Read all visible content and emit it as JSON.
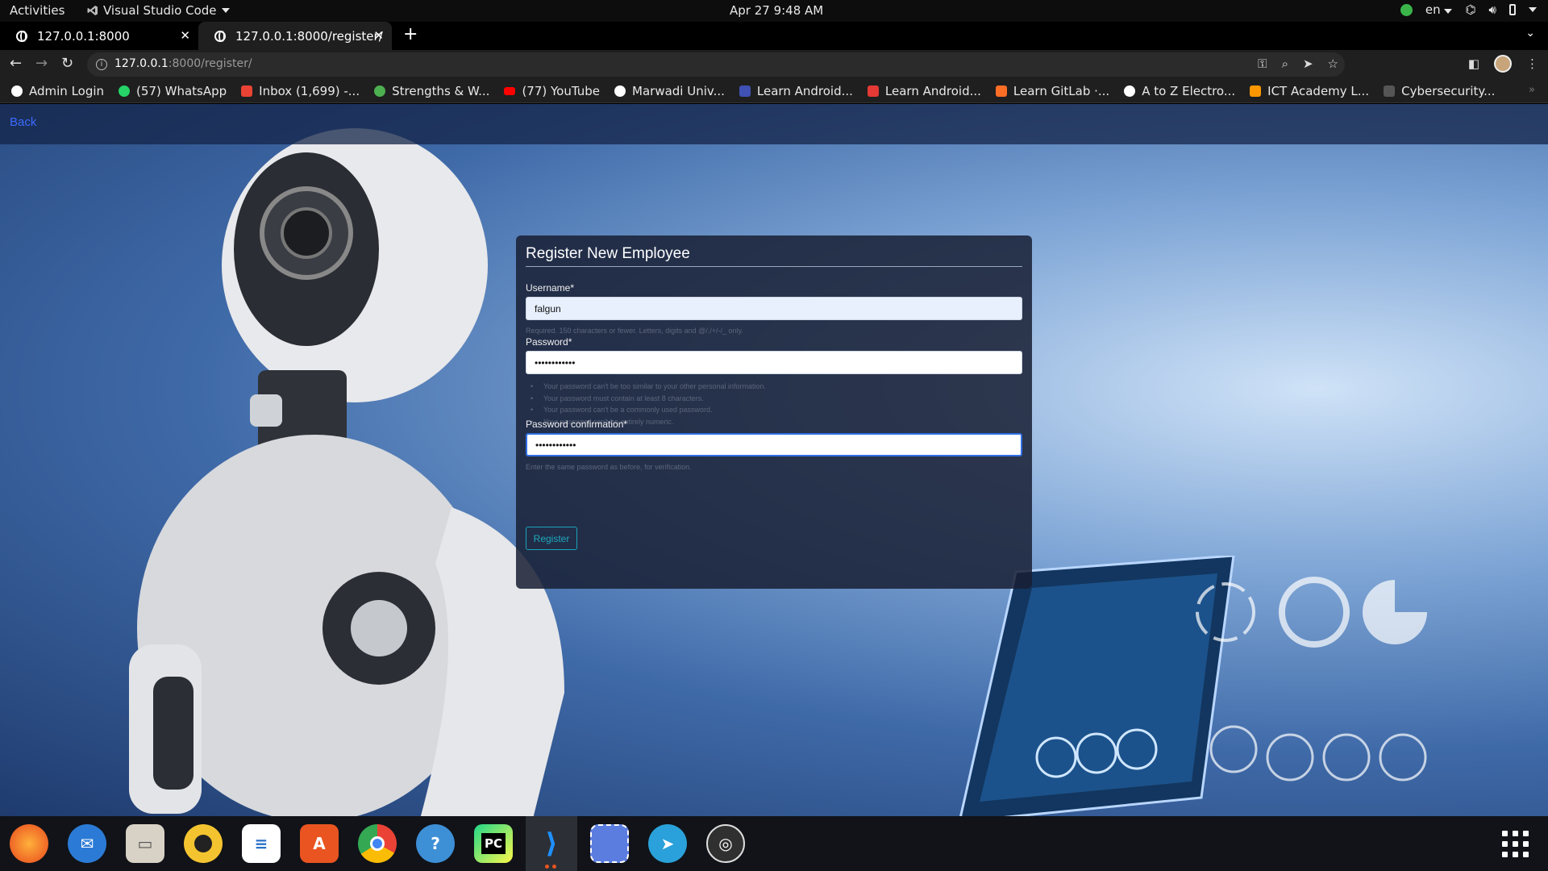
{
  "topbar": {
    "activities": "Activities",
    "app_name": "Visual Studio Code",
    "clock": "Apr 27  9:48 AM",
    "lang": "en"
  },
  "tabs": [
    {
      "title": "127.0.0.1:8000"
    },
    {
      "title": "127.0.0.1:8000/register/"
    }
  ],
  "address": {
    "host": "127.0.0.1",
    "path": ":8000/register/"
  },
  "bookmarks": [
    {
      "label": "Admin Login",
      "color": "#ffffff"
    },
    {
      "label": "(57) WhatsApp",
      "color": "#25d366"
    },
    {
      "label": "Inbox (1,699) -...",
      "color": "#ea4335"
    },
    {
      "label": "Strengths & W...",
      "color": "#4caf50"
    },
    {
      "label": "(77) YouTube",
      "color": "#ff0000"
    },
    {
      "label": "Marwadi Univ...",
      "color": "#ffffff"
    },
    {
      "label": "Learn Android...",
      "color": "#3f51b5"
    },
    {
      "label": "Learn Android...",
      "color": "#e53935"
    },
    {
      "label": "Learn GitLab ·...",
      "color": "#fc6d26"
    },
    {
      "label": "A to Z Electro...",
      "color": "#ffffff"
    },
    {
      "label": "ICT Academy L...",
      "color": "#ff9800"
    },
    {
      "label": "Cybersecurity...",
      "color": "#555555"
    }
  ],
  "page": {
    "back_link": "Back",
    "form": {
      "title": "Register New Employee",
      "username_label": "Username*",
      "username_value": "falgun",
      "username_help": "Required. 150 characters or fewer. Letters, digits and @/./+/-/_ only.",
      "password_label": "Password*",
      "password_value": "••••••••••••",
      "password_rules": [
        "Your password can't be too similar to your other personal information.",
        "Your password must contain at least 8 characters.",
        "Your password can't be a commonly used password.",
        "Your password can't be entirely numeric."
      ],
      "password2_label": "Password confirmation*",
      "password2_value": "••••••••••••",
      "password2_help": "Enter the same password as before, for verification.",
      "submit_label": "Register"
    }
  },
  "dock": {
    "apps": [
      {
        "name": "firefox",
        "color": "#ff7139"
      },
      {
        "name": "thunderbird",
        "color": "#2b7bd6"
      },
      {
        "name": "files",
        "color": "#cfc8bc"
      },
      {
        "name": "rhythmbox",
        "color": "#f4c430"
      },
      {
        "name": "libreoffice-writer",
        "color": "#2a72c8"
      },
      {
        "name": "ubuntu-software",
        "color": "#e95420"
      },
      {
        "name": "chrome",
        "color": "#4285f4"
      },
      {
        "name": "help",
        "color": "#3d8fd6"
      },
      {
        "name": "pycharm",
        "color": "#21d789"
      },
      {
        "name": "vscode",
        "color": "#1e90ff"
      },
      {
        "name": "screenshot",
        "color": "#5b7de0"
      },
      {
        "name": "telegram",
        "color": "#2aa1da"
      },
      {
        "name": "obs",
        "color": "#303030"
      }
    ]
  }
}
